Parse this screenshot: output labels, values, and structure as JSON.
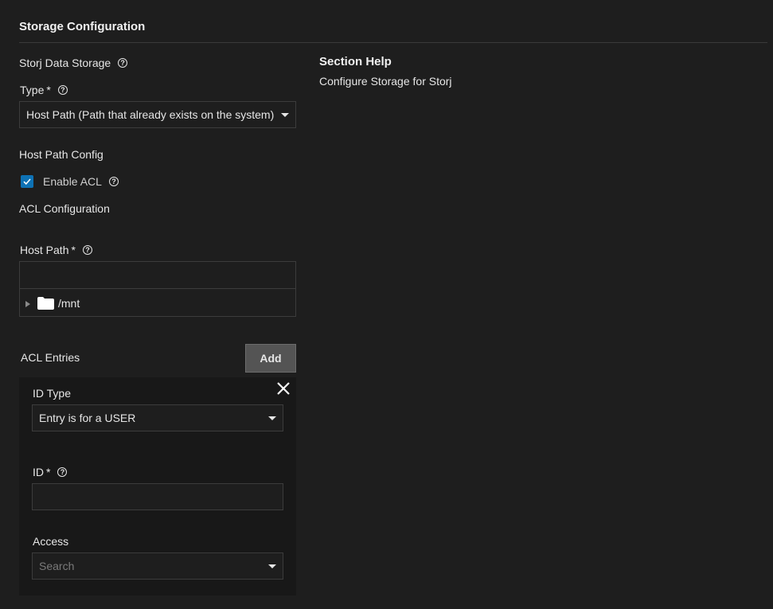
{
  "section": {
    "title": "Storage Configuration"
  },
  "help": {
    "title": "Section Help",
    "text": "Configure Storage for Storj"
  },
  "storj": {
    "label": "Storj Data Storage"
  },
  "type": {
    "label": "Type",
    "required": "*",
    "value": "Host Path (Path that already exists on the system)"
  },
  "host_path_config": {
    "label": "Host Path Config"
  },
  "enable_acl": {
    "label": "Enable ACL",
    "checked": true
  },
  "acl_config": {
    "label": "ACL Configuration"
  },
  "host_path": {
    "label": "Host Path",
    "required": "*",
    "input_value": "",
    "tree_root": "/mnt"
  },
  "acl_entries": {
    "label": "ACL Entries",
    "add_label": "Add",
    "entry": {
      "id_type_label": "ID Type",
      "id_type_value": "Entry is for a USER",
      "id_label": "ID",
      "id_required": "*",
      "id_value": "",
      "access_label": "Access",
      "access_placeholder": "Search"
    }
  },
  "colors": {
    "accent": "#0e72b5",
    "background": "#1e1e1e",
    "card": "#181818",
    "border": "#3c3c3c"
  }
}
